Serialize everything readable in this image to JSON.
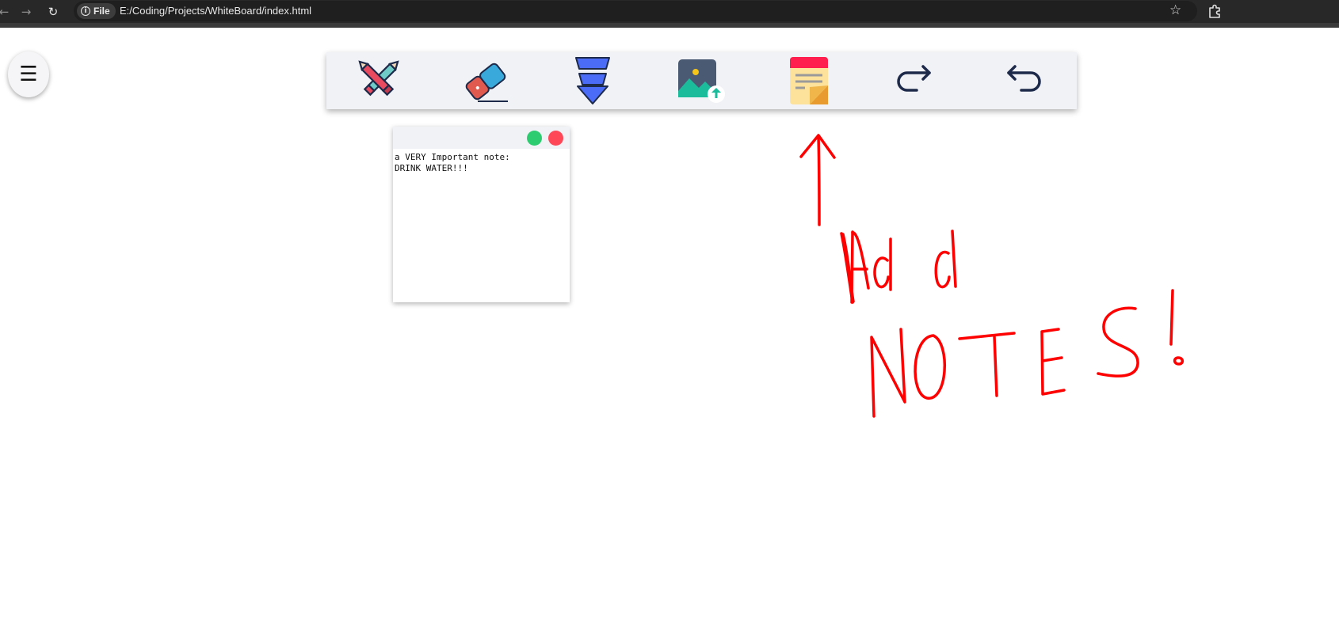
{
  "browser": {
    "back_label": "←",
    "forward_label": "→",
    "reload_label": "↻",
    "site_chip_label": "File",
    "url": "E:/Coding/Projects/WhiteBoard/index.html",
    "bookmark_icon": "star-icon",
    "extensions_icon": "puzzle-icon"
  },
  "app": {
    "menu_icon_glyph": "☰",
    "toolbar": {
      "tools": [
        {
          "name": "pencil-tool",
          "icon": "crossed-pencils-icon"
        },
        {
          "name": "eraser-tool",
          "icon": "eraser-icon"
        },
        {
          "name": "download-tool",
          "icon": "download-arrow-icon"
        },
        {
          "name": "image-upload-tool",
          "icon": "image-upload-icon"
        },
        {
          "name": "sticky-note-tool",
          "icon": "sticky-note-icon"
        },
        {
          "name": "redo-tool",
          "icon": "redo-arrow-icon"
        },
        {
          "name": "undo-tool",
          "icon": "undo-arrow-icon"
        }
      ]
    },
    "note": {
      "minimize_color": "#2ecc71",
      "close_color": "#ff4757",
      "content": "a VERY Important note:\nDRINK WATER!!!"
    },
    "canvas_annotation": {
      "color": "#ff0000",
      "lines": [
        "Add",
        "NOTES!"
      ]
    }
  }
}
